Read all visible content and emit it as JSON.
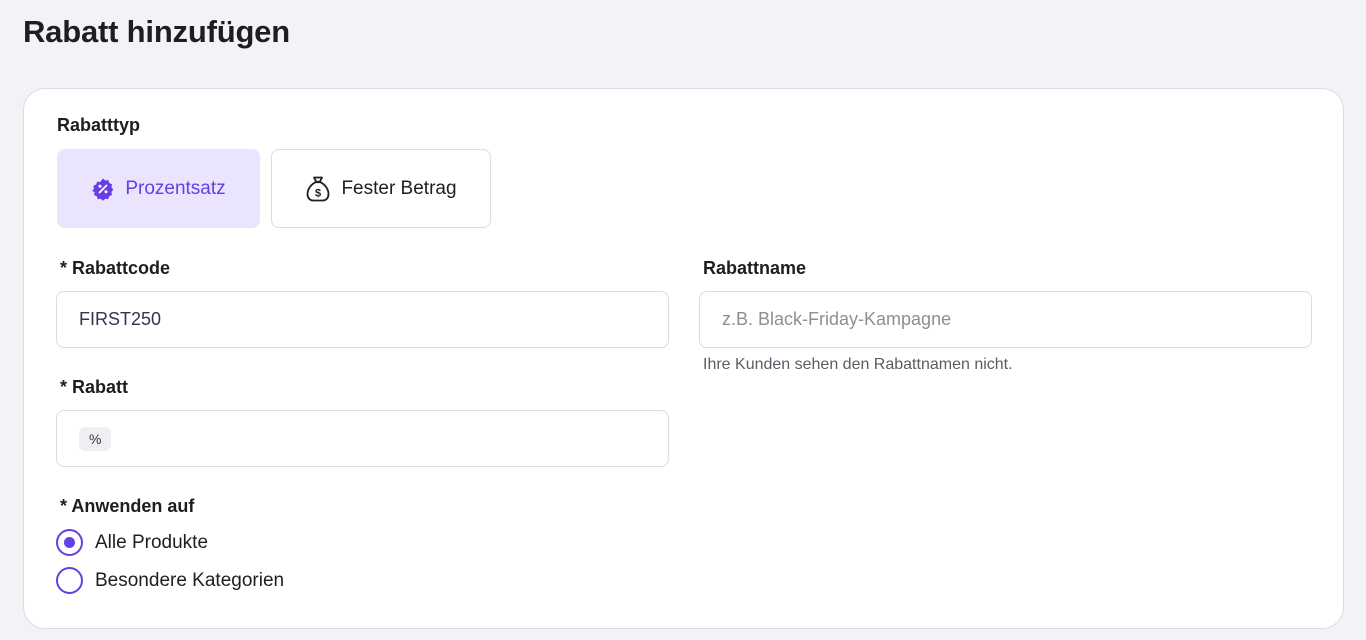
{
  "page": {
    "title": "Rabatt hinzufügen"
  },
  "discount_type": {
    "label": "Rabatttyp",
    "options": [
      {
        "label": "Prozentsatz",
        "icon": "percent-badge-icon",
        "selected": true
      },
      {
        "label": "Fester Betrag",
        "icon": "money-bag-icon",
        "selected": false
      }
    ]
  },
  "discount_code": {
    "label": "* Rabattcode",
    "value": "FIRST250"
  },
  "discount_name": {
    "label": "Rabattname",
    "placeholder": "z.B. Black-Friday-Kampagne",
    "helper": "Ihre Kunden sehen den Rabattnamen nicht."
  },
  "discount": {
    "label": "* Rabatt",
    "prefix": "%",
    "value": ""
  },
  "apply_to": {
    "label": "* Anwenden auf",
    "options": [
      {
        "label": "Alle Produkte",
        "selected": true
      },
      {
        "label": "Besondere Kategorien",
        "selected": false
      }
    ]
  },
  "colors": {
    "accent": "#673de6",
    "accent_light": "#ebe4ff",
    "background": "#f2f3f6",
    "border": "#dadce0"
  }
}
